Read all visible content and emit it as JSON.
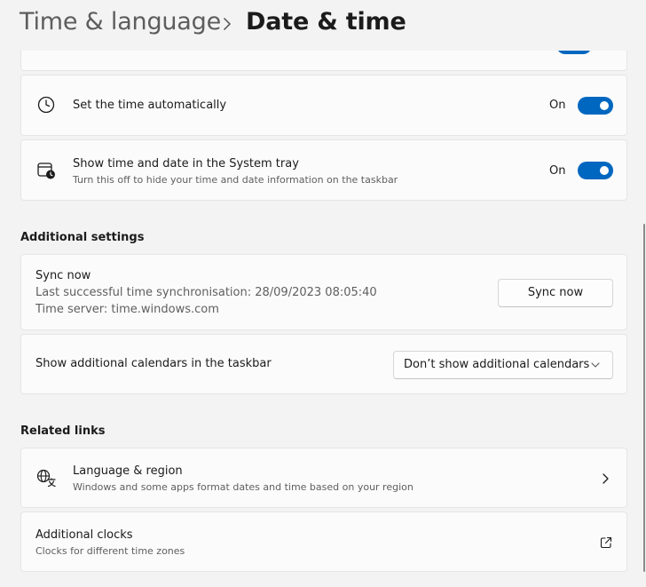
{
  "breadcrumb": {
    "parent": "Time & language",
    "current": "Date & time"
  },
  "settings": {
    "set_time_auto": {
      "title": "Set the time automatically",
      "state": "On",
      "enabled": true
    },
    "show_systray": {
      "title": "Show time and date in the System tray",
      "description": "Turn this off to hide your time and date information on the taskbar",
      "state": "On",
      "enabled": true
    }
  },
  "additional": {
    "heading": "Additional settings",
    "sync": {
      "title": "Sync now",
      "last_sync": "Last successful time synchronisation: 28/09/2023 08:05:40",
      "server": "Time server: time.windows.com",
      "button": "Sync now"
    },
    "calendars": {
      "title": "Show additional calendars in the taskbar",
      "selected": "Don’t show additional calendars"
    }
  },
  "related": {
    "heading": "Related links",
    "language_region": {
      "title": "Language & region",
      "description": "Windows and some apps format dates and time based on your region"
    },
    "additional_clocks": {
      "title": "Additional clocks",
      "description": "Clocks for different time zones"
    }
  },
  "colors": {
    "accent": "#0067c0",
    "background": "#f3f3f3",
    "card": "#fbfbfb"
  }
}
